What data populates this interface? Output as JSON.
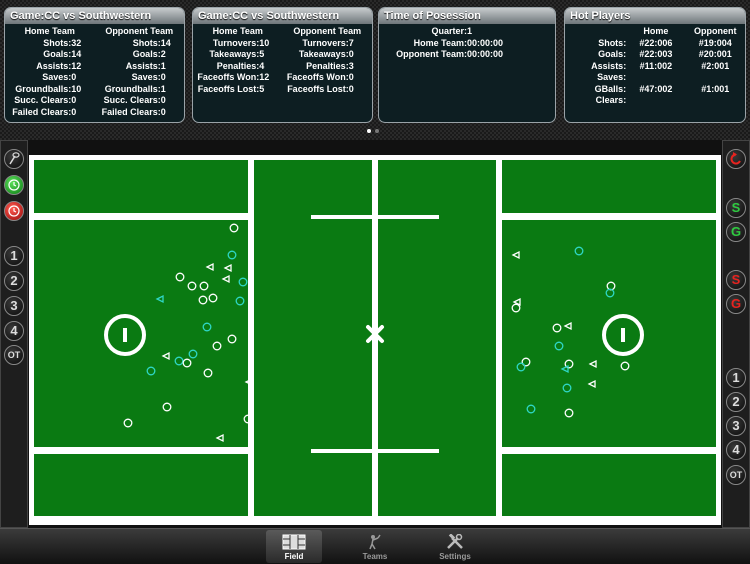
{
  "panels": {
    "game_stats_1": {
      "title": "Game:CC vs Southwestern",
      "headers": [
        "Home Team",
        "Opponent Team"
      ],
      "rows": [
        {
          "label": "Shots:",
          "home": "32",
          "opp_label": "Shots:",
          "opp": "14"
        },
        {
          "label": "Goals:",
          "home": "14",
          "opp_label": "Goals:",
          "opp": "2"
        },
        {
          "label": "Assists:",
          "home": "12",
          "opp_label": "Assists:",
          "opp": "1"
        },
        {
          "label": "Saves:",
          "home": "0",
          "opp_label": "Saves:",
          "opp": "0"
        },
        {
          "label": "Groundballs:",
          "home": "10",
          "opp_label": "Groundballs:",
          "opp": "1"
        },
        {
          "label": "Succ. Clears:",
          "home": "0",
          "opp_label": "Succ. Clears:",
          "opp": "0"
        },
        {
          "label": "Failed Clears:",
          "home": "0",
          "opp_label": "Failed Clears:",
          "opp": "0"
        }
      ]
    },
    "game_stats_2": {
      "title": "Game:CC vs Southwestern",
      "headers": [
        "Home Team",
        "Opponent Team"
      ],
      "rows": [
        {
          "label": "Turnovers:",
          "home": "10",
          "opp_label": "Turnovers:",
          "opp": "7"
        },
        {
          "label": "Takeaways:",
          "home": "5",
          "opp_label": "Takeaways:",
          "opp": "0"
        },
        {
          "label": "Penalties:",
          "home": "4",
          "opp_label": "Penalties:",
          "opp": "3"
        },
        {
          "label": "Faceoffs Won:",
          "home": "12",
          "opp_label": "Faceoffs Won:",
          "opp": "0"
        },
        {
          "label": "Faceoffs Lost:",
          "home": "5",
          "opp_label": "Faceoffs Lost:",
          "opp": "0"
        }
      ]
    },
    "possession": {
      "title": "Time of Posession",
      "quarter_label": "Quarter:",
      "quarter": "1",
      "home_label": "Home Team:",
      "home_time": "00:00:00",
      "opp_label": "Opponent Team:",
      "opp_time": "00:00:00"
    },
    "hot_players": {
      "title": "Hot Players",
      "headers": [
        "Home",
        "Opponent"
      ],
      "rows": [
        {
          "label": "Shots:",
          "home": "#22:006",
          "opp": "#19:004"
        },
        {
          "label": "Goals:",
          "home": "#22:003",
          "opp": "#20:001"
        },
        {
          "label": "Assists:",
          "home": "#11:002",
          "opp": "#2:001"
        },
        {
          "label": "Saves:",
          "home": "",
          "opp": ""
        },
        {
          "label": "GBalls:",
          "home": "#47:002",
          "opp": "#1:001"
        },
        {
          "label": "Clears:",
          "home": "",
          "opp": ""
        }
      ]
    }
  },
  "left_sidebar": {
    "icons": [
      "lacrosse-stick-icon",
      "green-clock-icon",
      "red-clock-icon"
    ],
    "quarters": [
      "1",
      "2",
      "3",
      "4",
      "OT"
    ]
  },
  "right_sidebar": {
    "undo_icon": "undo-icon",
    "buttons": [
      {
        "label": "S",
        "color": "#2ecc40"
      },
      {
        "label": "G",
        "color": "#2ecc40"
      },
      {
        "label": "S",
        "color": "#e8231f"
      },
      {
        "label": "G",
        "color": "#e8231f"
      }
    ],
    "quarters": [
      "1",
      "2",
      "3",
      "4",
      "OT"
    ]
  },
  "field": {
    "grass_color": "#0a7a12",
    "line_color": "#ffffff",
    "home_marker_color": "#ffffff",
    "opp_marker_color": "#2fd7c6"
  },
  "tabs": [
    {
      "label": "Field",
      "icon": "field-icon",
      "active": true
    },
    {
      "label": "Teams",
      "icon": "player-icon",
      "active": false
    },
    {
      "label": "Settings",
      "icon": "tools-icon",
      "active": false
    }
  ]
}
